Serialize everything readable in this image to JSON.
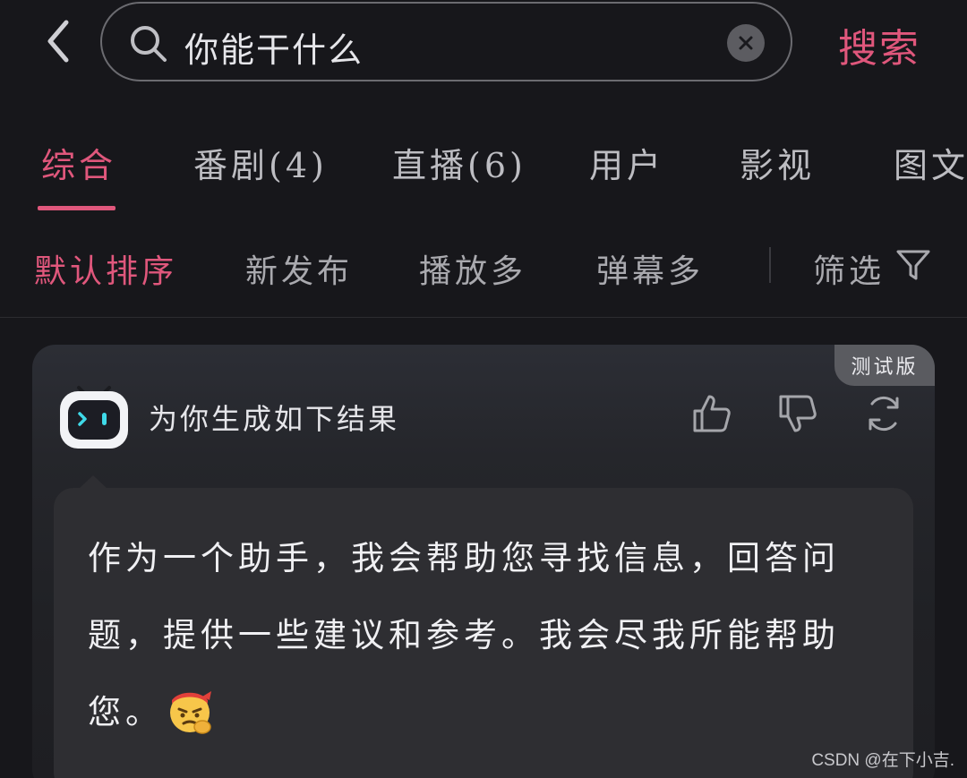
{
  "search": {
    "query": "你能干什么",
    "submit_label": "搜索"
  },
  "tabs": [
    {
      "label": "综合",
      "active": true
    },
    {
      "label": "番剧(4)",
      "active": false
    },
    {
      "label": "直播(6)",
      "active": false
    },
    {
      "label": "用户",
      "active": false
    },
    {
      "label": "影视",
      "active": false
    },
    {
      "label": "图文",
      "active": false
    }
  ],
  "sort": {
    "options": [
      {
        "label": "默认排序",
        "active": true
      },
      {
        "label": "新发布",
        "active": false
      },
      {
        "label": "播放多",
        "active": false
      },
      {
        "label": "弹幕多",
        "active": false
      }
    ],
    "filter_label": "筛选"
  },
  "ai_card": {
    "badge": "测试版",
    "title": "为你生成如下结果",
    "answer": "作为一个助手，我会帮助您寻找信息，回答问题，提供一些建议和参考。我会尽我所能帮助您。",
    "emoji": "thinking-face-with-headband-icon"
  },
  "icons": [
    "back-arrow-icon",
    "search-icon",
    "clear-icon",
    "filter-funnel-icon",
    "robot-avatar-icon",
    "thumbs-up-icon",
    "thumbs-down-icon",
    "refresh-icon"
  ],
  "colors": {
    "background": "#17171b",
    "accent": "#e0577c",
    "card": "#2e2e32"
  },
  "watermark": "CSDN @在下小吉."
}
